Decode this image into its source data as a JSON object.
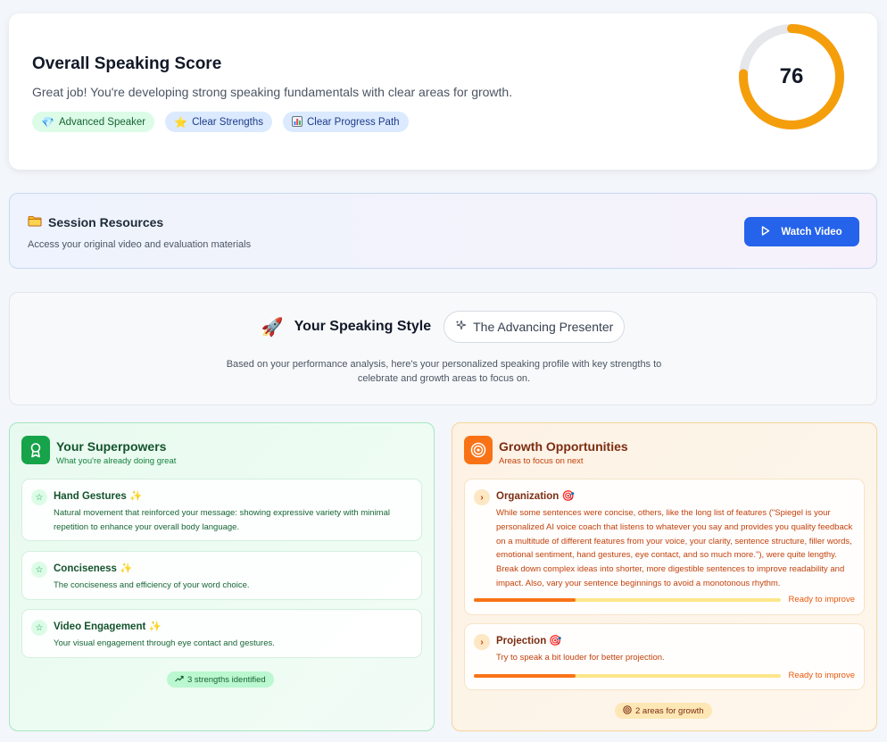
{
  "score": {
    "title": "Overall Speaking Score",
    "subtitle": "Great job! You're developing strong speaking fundamentals with clear areas for growth.",
    "value": "76",
    "fraction": 0.76,
    "ring_color": "#f59e0b",
    "badges": [
      {
        "icon": "gem-icon",
        "label": "Advanced Speaker"
      },
      {
        "icon": "star-icon",
        "label": "Clear Strengths"
      },
      {
        "icon": "bar-chart-icon",
        "label": "Clear Progress Path"
      }
    ]
  },
  "resources": {
    "title": "Session Resources",
    "subtitle": "Access your original video and evaluation materials",
    "button_label": "Watch Video"
  },
  "style": {
    "title": "Your Speaking Style",
    "persona": "The Advancing Presenter",
    "description": "Based on your performance analysis, here's your personalized speaking profile with key strengths to celebrate and growth areas to focus on."
  },
  "superpowers": {
    "title": "Your Superpowers",
    "subtitle": "What you're already doing great",
    "items": [
      {
        "title": "Hand Gestures ✨",
        "desc": "Natural movement that reinforced your message: showing expressive variety with minimal repetition to enhance your overall body language."
      },
      {
        "title": "Conciseness ✨",
        "desc": "The conciseness and efficiency of your word choice."
      },
      {
        "title": "Video Engagement ✨",
        "desc": "Your visual engagement through eye contact and gestures."
      }
    ],
    "footer": "3 strengths identified"
  },
  "growth": {
    "title": "Growth Opportunities",
    "subtitle": "Areas to focus on next",
    "items": [
      {
        "title": "Organization 🎯",
        "desc": "While some sentences were concise, others, like the long list of features (\"Spiegel is your personalized AI voice coach that listens to whatever you say and provides you quality feedback on a multitude of different features from your voice, your clarity, sentence structure, filler words, emotional sentiment, hand gestures, eye contact, and so much more.\"), were quite lengthy. Break down complex ideas into shorter, more digestible sentences to improve readability and impact. Also, vary your sentence beginnings to avoid a monotonous rhythm.",
        "status": "Ready to improve",
        "progress": 0.33
      },
      {
        "title": "Projection 🎯",
        "desc": "Try to speak a bit louder for better projection.",
        "status": "Ready to improve",
        "progress": 0.33
      }
    ],
    "footer": "2 areas for growth"
  }
}
